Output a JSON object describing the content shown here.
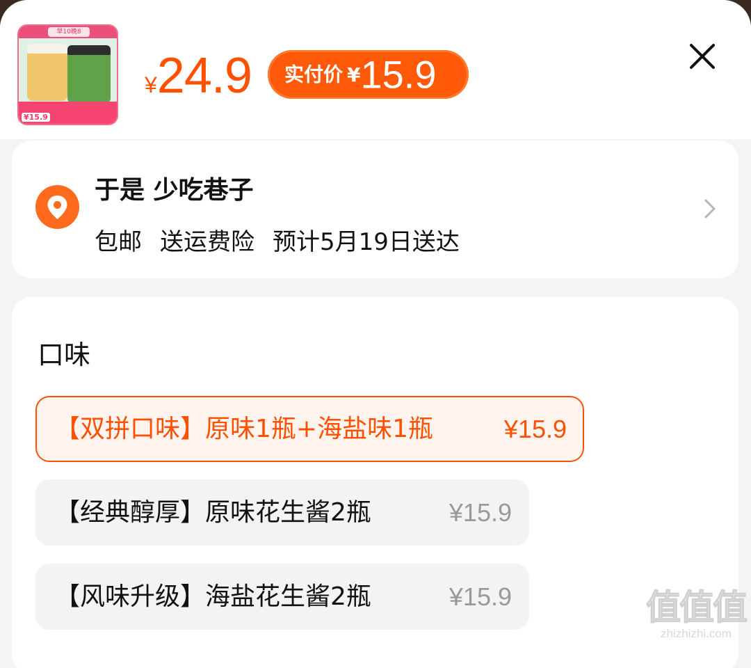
{
  "product": {
    "thumbnail_badge": "早10晚8",
    "thumbnail_price": "¥15.9",
    "currency": "¥",
    "original_price": "24.9",
    "pay_label": "实付价",
    "pay_currency": "¥",
    "pay_price": "15.9"
  },
  "header": {
    "close_icon": "close-icon"
  },
  "address": {
    "name": "于是 少吃巷子",
    "shipping": "包邮",
    "insurance": "送运费险",
    "delivery": "预计5月19日送达",
    "icon": "location-pin-icon"
  },
  "flavor": {
    "title": "口味",
    "options": [
      {
        "label": "【双拼口味】原味1瓶+海盐味1瓶",
        "price": "¥15.9",
        "selected": true
      },
      {
        "label": "【经典醇厚】原味花生酱2瓶",
        "price": "¥15.9",
        "selected": false
      },
      {
        "label": "【风味升级】海盐花生酱2瓶",
        "price": "¥15.9",
        "selected": false
      }
    ]
  },
  "watermark": {
    "logo_text": "值值值",
    "site": "zhizhizhi.com"
  },
  "colors": {
    "accent": "#ff5000",
    "pill": "#ff5a0a",
    "page_bg": "#f4f4f4"
  }
}
